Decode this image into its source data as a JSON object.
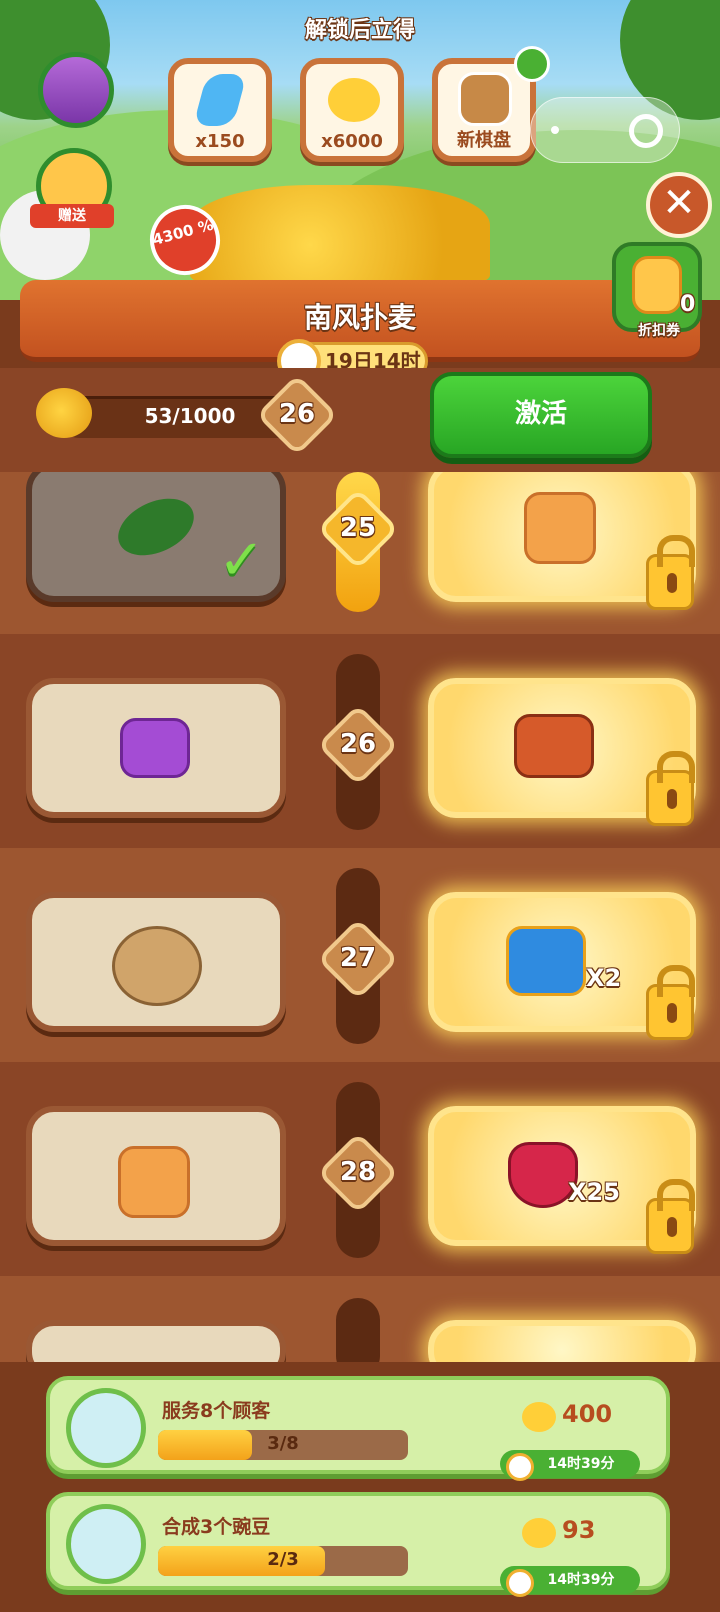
{
  "header": {
    "unlock_title": "解锁后立得",
    "rewards": [
      {
        "label": "x150",
        "icon": "lightning-icon"
      },
      {
        "label": "x6000",
        "icon": "bee-icon"
      },
      {
        "label": "新棋盘",
        "icon": "board-icon"
      }
    ],
    "gift_label": "赠送",
    "bonus_badge": "4300 %",
    "close_icon": "close-icon"
  },
  "event": {
    "title": "南风扑麦",
    "timer": "19日14时",
    "coupon_label": "折扣券",
    "coupon_count": "0"
  },
  "progress": {
    "bee_count": "53/1000",
    "current_level": "26",
    "activate_label": "激活"
  },
  "track": {
    "rows": [
      {
        "level": "25",
        "left_item": "cucumber-icon",
        "claimed": true,
        "right_item": "mystery-box-icon",
        "right_mult": ""
      },
      {
        "level": "26",
        "left_item": "purple-box-icon",
        "claimed": false,
        "right_item": "treasure-chest-icon",
        "right_mult": ""
      },
      {
        "level": "27",
        "left_item": "fish-basket-icon",
        "claimed": false,
        "right_item": "blue-chest-icon",
        "right_mult": "X2"
      },
      {
        "level": "28",
        "left_item": "mystery-box-icon",
        "claimed": false,
        "right_item": "ruby-icon",
        "right_mult": "X25"
      }
    ]
  },
  "tasks": [
    {
      "title": "服务8个顾客",
      "progress": "3/8",
      "progress_ratio": 0.375,
      "reward": "400",
      "time": "14时39分",
      "avatar": "farmer-avatar"
    },
    {
      "title": "合成3个豌豆",
      "progress": "2/3",
      "progress_ratio": 0.667,
      "reward": "93",
      "time": "14时39分",
      "avatar": "pea-pod-icon"
    }
  ]
}
